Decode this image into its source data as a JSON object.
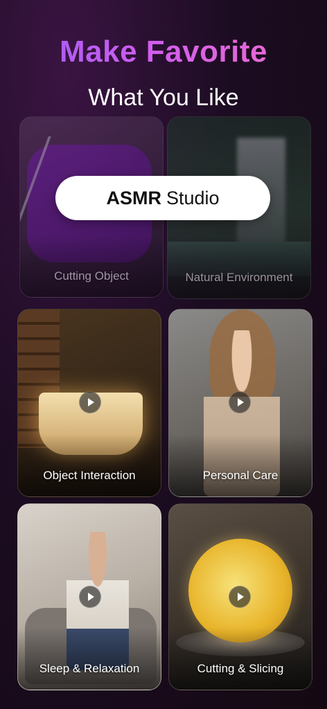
{
  "header": {
    "title": "Make Favorite",
    "subtitle": "What You Like"
  },
  "badge": {
    "bold": "ASMR",
    "regular": "Studio"
  },
  "categories": [
    {
      "label": "Cutting Object"
    },
    {
      "label": "Natural Environment"
    },
    {
      "label": "Object Interaction"
    },
    {
      "label": "Personal Care"
    },
    {
      "label": "Sleep & Relaxation"
    },
    {
      "label": "Cutting & Slicing"
    }
  ],
  "colors": {
    "title_gradient_start": "#9a5cf5",
    "title_gradient_end": "#f06fc7",
    "background": "#1c0c22"
  }
}
